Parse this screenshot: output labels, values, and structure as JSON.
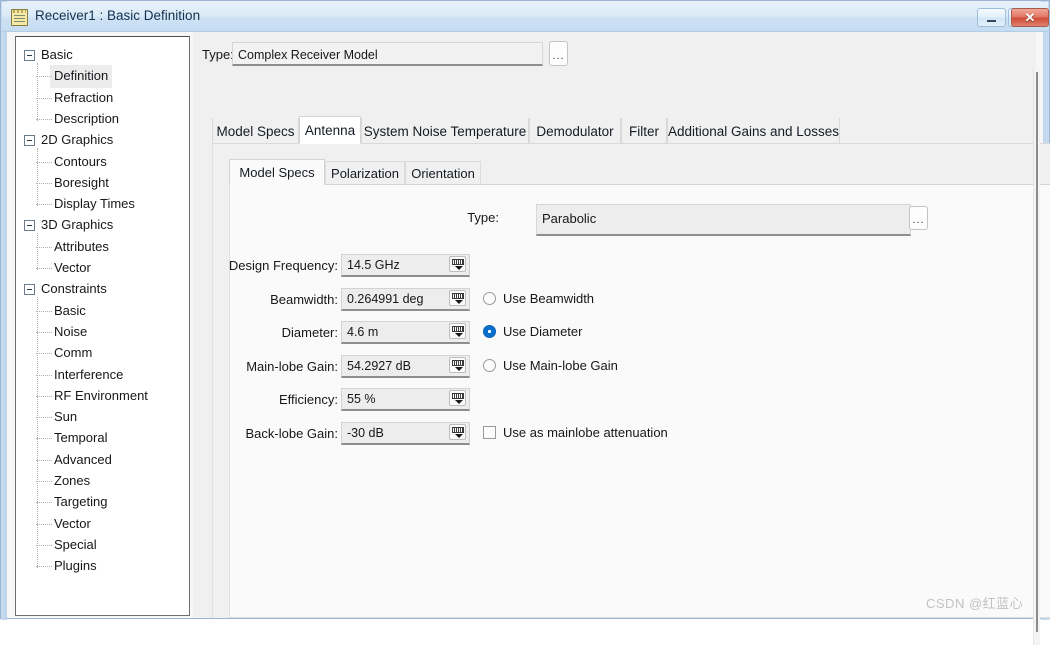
{
  "window": {
    "title": "Receiver1 : Basic Definition",
    "icon": "notepad-icon",
    "buttons": {
      "minimize": "—",
      "maximize": "□",
      "close": "✕"
    }
  },
  "tree": {
    "items": [
      {
        "label": "Basic",
        "type": "group",
        "expanded": true,
        "selected": false
      },
      {
        "label": "Definition",
        "type": "child",
        "expanded": false,
        "selected": true
      },
      {
        "label": "Refraction",
        "type": "child",
        "expanded": false,
        "selected": false
      },
      {
        "label": "Description",
        "type": "child",
        "expanded": false,
        "selected": false
      },
      {
        "label": "2D Graphics",
        "type": "group",
        "expanded": true,
        "selected": false
      },
      {
        "label": "Contours",
        "type": "child",
        "expanded": false,
        "selected": false
      },
      {
        "label": "Boresight",
        "type": "child",
        "expanded": false,
        "selected": false
      },
      {
        "label": "Display Times",
        "type": "child",
        "expanded": false,
        "selected": false
      },
      {
        "label": "3D Graphics",
        "type": "group",
        "expanded": true,
        "selected": false
      },
      {
        "label": "Attributes",
        "type": "child",
        "expanded": false,
        "selected": false
      },
      {
        "label": "Vector",
        "type": "child",
        "expanded": false,
        "selected": false
      },
      {
        "label": "Constraints",
        "type": "group",
        "expanded": true,
        "selected": false
      },
      {
        "label": "Basic",
        "type": "child",
        "expanded": false,
        "selected": false
      },
      {
        "label": "Noise",
        "type": "child",
        "expanded": false,
        "selected": false
      },
      {
        "label": "Comm",
        "type": "child",
        "expanded": false,
        "selected": false
      },
      {
        "label": "Interference",
        "type": "child",
        "expanded": false,
        "selected": false
      },
      {
        "label": "RF Environment",
        "type": "child",
        "expanded": false,
        "selected": false
      },
      {
        "label": "Sun",
        "type": "child",
        "expanded": false,
        "selected": false
      },
      {
        "label": "Temporal",
        "type": "child",
        "expanded": false,
        "selected": false
      },
      {
        "label": "Advanced",
        "type": "child",
        "expanded": false,
        "selected": false
      },
      {
        "label": "Zones",
        "type": "child",
        "expanded": false,
        "selected": false
      },
      {
        "label": "Targeting",
        "type": "child",
        "expanded": false,
        "selected": false
      },
      {
        "label": "Vector",
        "type": "child",
        "expanded": false,
        "selected": false
      },
      {
        "label": "Special",
        "type": "child",
        "expanded": false,
        "selected": false
      },
      {
        "label": "Plugins",
        "type": "child",
        "expanded": false,
        "selected": false
      }
    ]
  },
  "receiver": {
    "type_label": "Type:",
    "type_value": "Complex Receiver Model",
    "browse_label": "..."
  },
  "outer_tabs": [
    {
      "label": "Model Specs",
      "active": false
    },
    {
      "label": "Antenna",
      "active": true
    },
    {
      "label": "System Noise Temperature",
      "active": false
    },
    {
      "label": "Demodulator",
      "active": false
    },
    {
      "label": "Filter",
      "active": false
    },
    {
      "label": "Additional Gains and Losses",
      "active": false
    }
  ],
  "inner_tabs": [
    {
      "label": "Model Specs",
      "active": true
    },
    {
      "label": "Polarization",
      "active": false
    },
    {
      "label": "Orientation",
      "active": false
    }
  ],
  "antenna": {
    "type_label": "Type:",
    "type_value": "Parabolic",
    "browse_label": "...",
    "fields": [
      {
        "label": "Design Frequency:",
        "value": "14.5 GHz",
        "option": null,
        "option_kind": null,
        "option_checked": false
      },
      {
        "label": "Beamwidth:",
        "value": "0.264991 deg",
        "option": "Use Beamwidth",
        "option_kind": "radio",
        "option_checked": false
      },
      {
        "label": "Diameter:",
        "value": "4.6 m",
        "option": "Use Diameter",
        "option_kind": "radio",
        "option_checked": true
      },
      {
        "label": "Main-lobe Gain:",
        "value": "54.2927 dB",
        "option": "Use Main-lobe Gain",
        "option_kind": "radio",
        "option_checked": false
      },
      {
        "label": "Efficiency:",
        "value": "55 %",
        "option": null,
        "option_kind": null,
        "option_checked": false
      },
      {
        "label": "Back-lobe Gain:",
        "value": "-30 dB",
        "option": "Use as mainlobe attenuation",
        "option_kind": "checkbox",
        "option_checked": false
      }
    ]
  },
  "watermark": "CSDN @红蓝心",
  "colors": {
    "accent": "#0a6ecd",
    "titlebar": "#cfe2f4",
    "close": "#cf4e36",
    "panel": "#f0f0f0"
  }
}
